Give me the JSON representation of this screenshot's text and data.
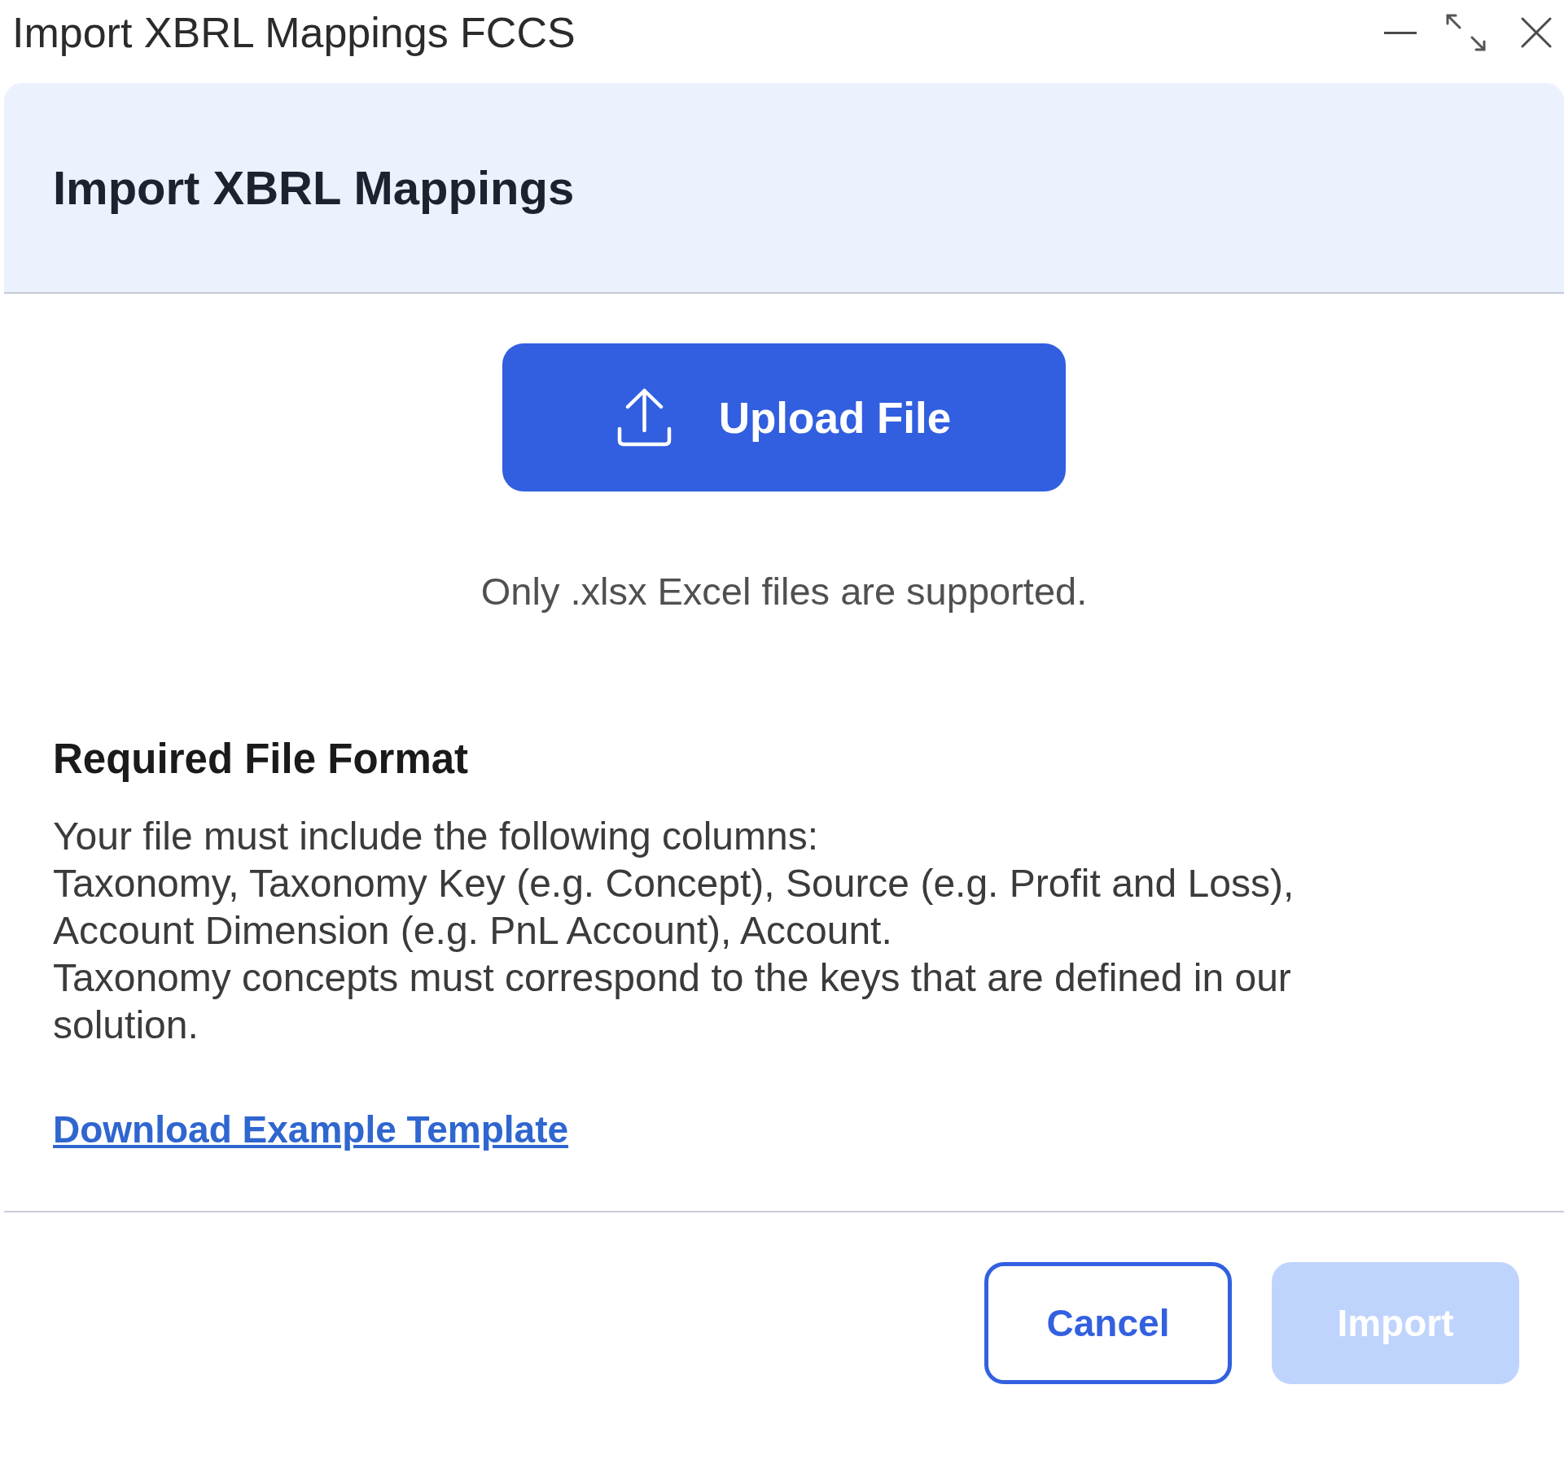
{
  "window": {
    "title": "Import XBRL Mappings FCCS"
  },
  "dialog": {
    "title": "Import XBRL Mappings",
    "upload_button": {
      "label": "Upload File"
    },
    "hint": "Only .xlsx Excel files are supported.",
    "format": {
      "heading": "Required File Format",
      "lines": [
        "Your file must include the following columns:",
        "Taxonomy, Taxonomy Key (e.g. Concept), Source (e.g. Profit and Loss), Account Dimension (e.g. PnL Account), Account.",
        "Taxonomy concepts must correspond to the keys that are defined in our solution."
      ],
      "link": "Download Example Template"
    },
    "buttons": [
      {
        "label": "Cancel",
        "kind": "outline",
        "disabled": false
      },
      {
        "label": "Import",
        "kind": "filled",
        "disabled": true
      }
    ]
  }
}
